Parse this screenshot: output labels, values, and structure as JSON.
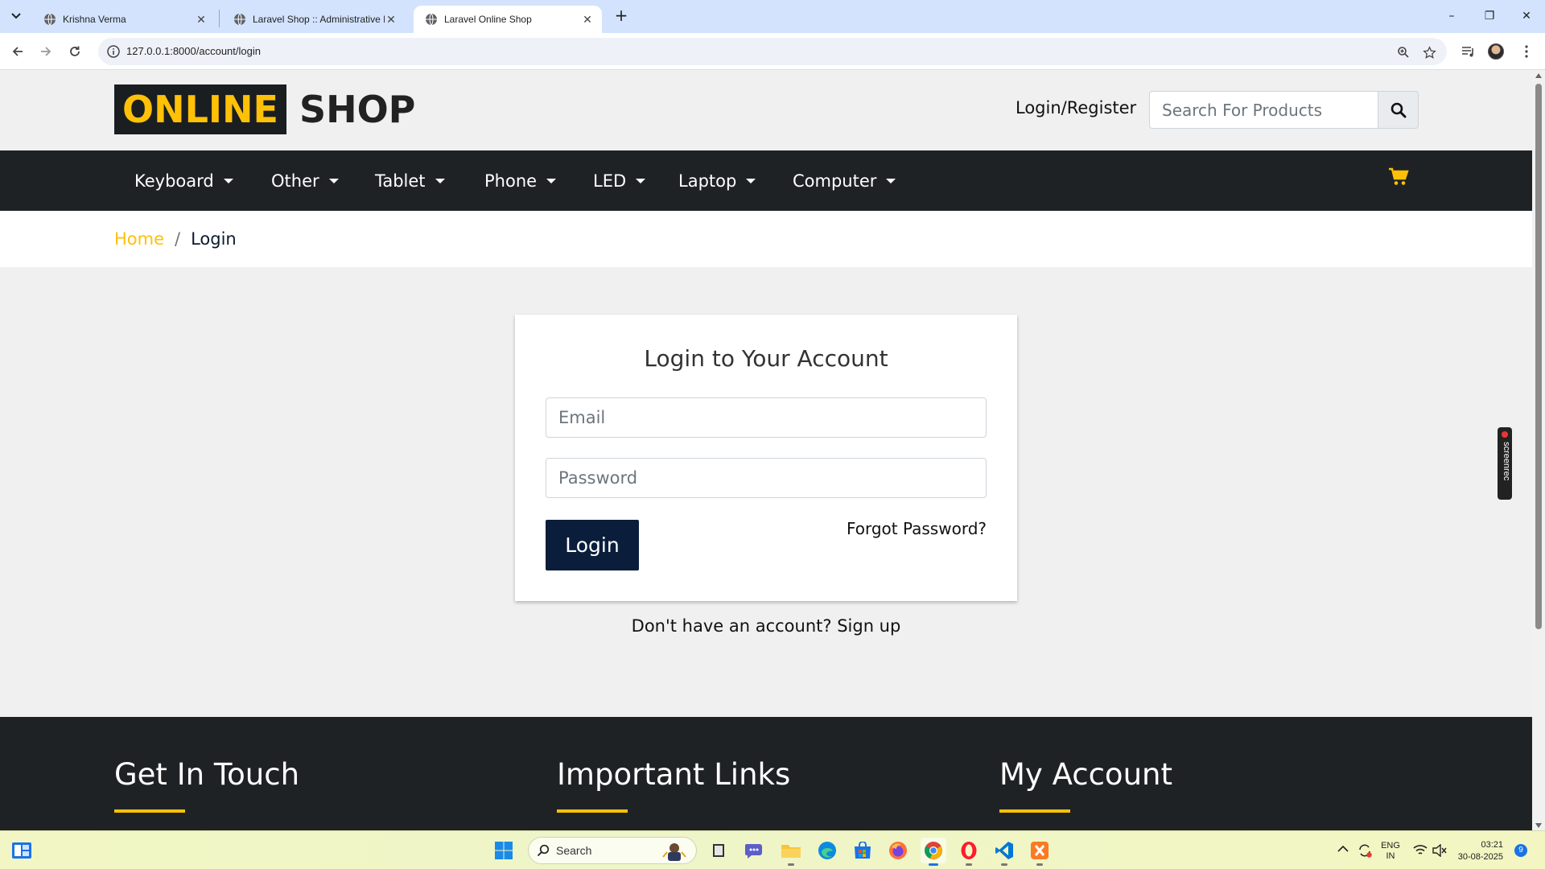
{
  "browser": {
    "tabs": [
      {
        "title": "Krishna Verma",
        "active": false
      },
      {
        "title": "Laravel Shop :: Administrative P",
        "active": false
      },
      {
        "title": "Laravel Online Shop",
        "active": true
      }
    ],
    "new_tab_label": "+",
    "url": "127.0.0.1:8000/account/login",
    "window_controls": {
      "minimize": "–",
      "restore": "❐",
      "close": "✕"
    }
  },
  "site": {
    "logo": {
      "part1": "ONLINE",
      "part2": "SHOP"
    },
    "login_register": "Login/Register",
    "search": {
      "placeholder": "Search For Products"
    },
    "nav": [
      "Keyboard",
      "Other",
      "Tablet",
      "Phone",
      "LED",
      "Laptop",
      "Computer"
    ],
    "breadcrumb": {
      "home": "Home",
      "separator": "/",
      "current": "Login"
    },
    "colors": {
      "accent": "#ffc107",
      "dark": "#1f2225",
      "button": "#0a1e3c"
    }
  },
  "login": {
    "title": "Login to Your Account",
    "email_placeholder": "Email",
    "password_placeholder": "Password",
    "login_button": "Login",
    "forgot_password": "Forgot Password?",
    "signup_prompt": "Don't have an account? Sign up"
  },
  "footer": {
    "columns": [
      "Get In Touch",
      "Important Links",
      "My Account"
    ]
  },
  "overlay": {
    "screenrec": "screenrec"
  },
  "taskbar": {
    "search_label": "Search",
    "lang_line1": "ENG",
    "lang_line2": "IN",
    "time": "03:21",
    "date": "30-08-2025",
    "notifications": "9",
    "apps": [
      "file-explorer-dark",
      "teams",
      "file-explorer",
      "edge",
      "microsoft-store",
      "firefox",
      "chrome",
      "opera",
      "vscode",
      "xampp"
    ]
  }
}
